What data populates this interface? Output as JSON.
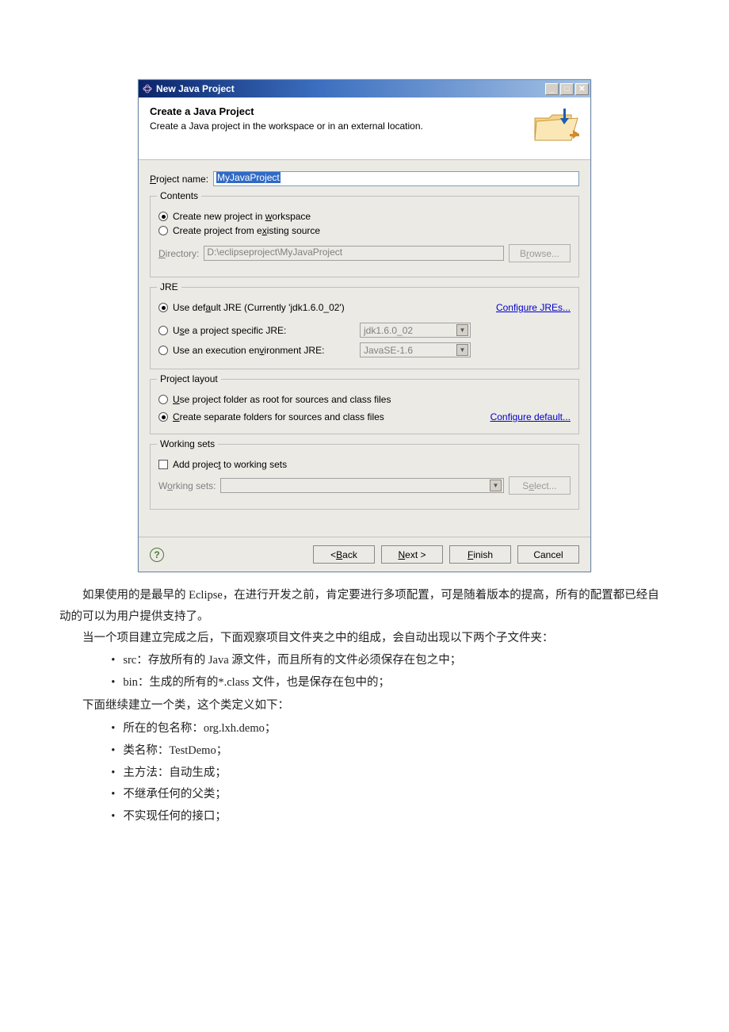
{
  "dialog": {
    "title": "New Java Project",
    "header_title": "Create a Java Project",
    "header_desc": "Create a Java project in the workspace or in an external location.",
    "project_name_label": "Project name:",
    "project_name_value": "MyJavaProject",
    "contents": {
      "legend": "Contents",
      "opt_workspace": "Create new project in workspace",
      "opt_existing": "Create project from existing source",
      "directory_label": "Directory:",
      "directory_value": "D:\\eclipseproject\\MyJavaProject",
      "browse_btn": "Browse..."
    },
    "jre": {
      "legend": "JRE",
      "opt_default": "Use default JRE (Currently 'jdk1.6.0_02')",
      "configure_link": "Configure JREs...",
      "opt_specific": "Use a project specific JRE:",
      "specific_value": "jdk1.6.0_02",
      "opt_execenv": "Use an execution environment JRE:",
      "execenv_value": "JavaSE-1.6"
    },
    "layout": {
      "legend": "Project layout",
      "opt_root": "Use project folder as root for sources and class files",
      "opt_separate": "Create separate folders for sources and class files",
      "configure_link": "Configure default..."
    },
    "workingsets": {
      "legend": "Working sets",
      "check_label": "Add project to working sets",
      "ws_label": "Working sets:",
      "select_btn": "Select..."
    },
    "footer": {
      "back": "< Back",
      "next": "Next >",
      "finish": "Finish",
      "cancel": "Cancel"
    }
  },
  "prose": {
    "p1": "如果使用的是最早的 Eclipse，在进行开发之前，肯定要进行多项配置，可是随着版本的提高，所有的配置都已经自动的可以为用户提供支持了。",
    "p2": "当一个项目建立完成之后，下面观察项目文件夹之中的组成，会自动出现以下两个子文件夹：",
    "li1": "src：存放所有的 Java 源文件，而且所有的文件必须保存在包之中；",
    "li2": "bin：生成的所有的*.class 文件，也是保存在包中的；",
    "p3": "下面继续建立一个类，这个类定义如下：",
    "li3": "所在的包名称：org.lxh.demo；",
    "li4": "类名称：TestDemo；",
    "li5": "主方法：自动生成；",
    "li6": "不继承任何的父类；",
    "li7": "不实现任何的接口；"
  }
}
